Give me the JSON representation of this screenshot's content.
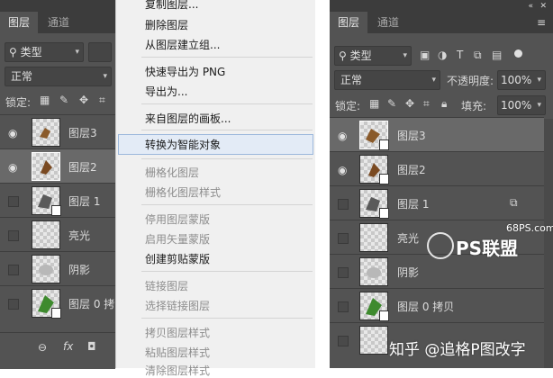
{
  "left_panel": {
    "tabs": [
      "图层",
      "通道"
    ],
    "filter_label": "类型",
    "blend_mode": "正常",
    "lock_label": "锁定:",
    "layers": [
      {
        "name": "图层3",
        "visible": true
      },
      {
        "name": "图层2",
        "visible": true,
        "selected": true
      },
      {
        "name": "图层 1",
        "visible": false
      },
      {
        "name": "亮光",
        "visible": false
      },
      {
        "name": "阴影",
        "visible": false
      },
      {
        "name": "图层 0 拷",
        "visible": false
      }
    ],
    "bottom_icons": [
      "link-icon",
      "fx-icon",
      "mask-icon"
    ]
  },
  "context_menu": {
    "items": [
      {
        "label": "复制图层...",
        "disabled": false
      },
      {
        "label": "删除图层",
        "disabled": false
      },
      {
        "label": "从图层建立组...",
        "disabled": false
      },
      {
        "label": "快速导出为 PNG",
        "disabled": false
      },
      {
        "label": "导出为...",
        "disabled": false
      },
      {
        "label": "来自图层的画板...",
        "disabled": false
      },
      {
        "label": "转换为智能对象",
        "disabled": false,
        "highlighted": true
      },
      {
        "label": "栅格化图层",
        "disabled": true
      },
      {
        "label": "栅格化图层样式",
        "disabled": true
      },
      {
        "label": "停用图层蒙版",
        "disabled": true
      },
      {
        "label": "启用矢量蒙版",
        "disabled": true
      },
      {
        "label": "创建剪贴蒙版",
        "disabled": false
      },
      {
        "label": "链接图层",
        "disabled": true
      },
      {
        "label": "选择链接图层",
        "disabled": true
      },
      {
        "label": "拷贝图层样式",
        "disabled": true
      },
      {
        "label": "粘贴图层样式",
        "disabled": true
      },
      {
        "label": "清除图层样式",
        "disabled": true
      }
    ]
  },
  "right_panel": {
    "tabs": [
      "图层",
      "通道"
    ],
    "filter_label": "类型",
    "blend_mode": "正常",
    "opacity_label": "不透明度:",
    "opacity_value": "100%",
    "lock_label": "锁定:",
    "fill_label": "填充:",
    "fill_value": "100%",
    "layers": [
      {
        "name": "图层3",
        "visible": true,
        "selected": true
      },
      {
        "name": "图层2",
        "visible": true
      },
      {
        "name": "图层 1",
        "visible": false
      },
      {
        "name": "亮光",
        "visible": false
      },
      {
        "name": "阴影",
        "visible": false
      },
      {
        "name": "图层 0 拷贝",
        "visible": false
      }
    ]
  },
  "watermarks": {
    "site": "68PS.com",
    "brand": "PS联盟",
    "zhihu": "知乎 @追格P图改字"
  }
}
